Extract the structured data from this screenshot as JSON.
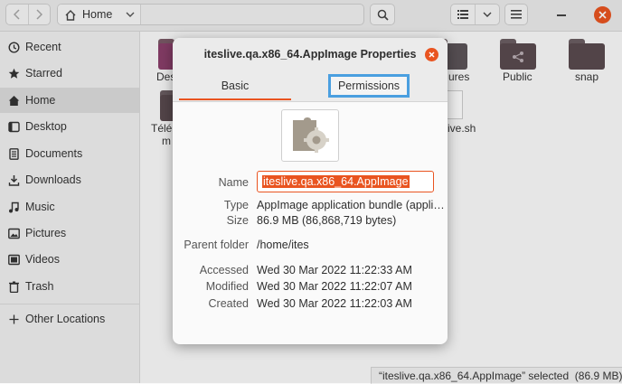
{
  "header": {
    "back_icon": "chevron-left-icon",
    "forward_icon": "chevron-right-icon",
    "path_home_label": "Home",
    "path_dropdown_icon": "chevron-down-icon",
    "search_icon": "search-icon",
    "view_list_icon": "list-view-icon",
    "view_options_icon": "chevron-down-icon",
    "menu_icon": "hamburger-menu-icon",
    "window_minimize_icon": "minimize-icon",
    "window_close_icon": "close-icon"
  },
  "sidebar": {
    "items": [
      {
        "label": "Recent",
        "icon": "clock-icon"
      },
      {
        "label": "Starred",
        "icon": "star-icon"
      },
      {
        "label": "Home",
        "icon": "home-icon"
      },
      {
        "label": "Desktop",
        "icon": "desktop-icon"
      },
      {
        "label": "Documents",
        "icon": "documents-icon"
      },
      {
        "label": "Downloads",
        "icon": "download-icon"
      },
      {
        "label": "Music",
        "icon": "music-icon"
      },
      {
        "label": "Pictures",
        "icon": "pictures-icon"
      },
      {
        "label": "Videos",
        "icon": "videos-icon"
      },
      {
        "label": "Trash",
        "icon": "trash-icon"
      }
    ],
    "other_locations": "Other Locations"
  },
  "content": {
    "files": [
      {
        "label": "Des"
      },
      {
        "label": "ures"
      },
      {
        "label": "Public"
      },
      {
        "label": "snap"
      },
      {
        "label": "Télé"
      },
      {
        "label": "m"
      },
      {
        "label": "ive.sh"
      }
    ],
    "status": "“iteslive.qa.x86_64.AppImage” selected  (86.9 MB)"
  },
  "dialog": {
    "title": "iteslive.qa.x86_64.AppImage Properties",
    "close_icon": "close-icon",
    "tabs": {
      "basic": "Basic",
      "permissions": "Permissions"
    },
    "app_icon": "puzzle-gear-icon",
    "labels": {
      "name": "Name",
      "type": "Type",
      "size": "Size",
      "parent_folder": "Parent folder",
      "accessed": "Accessed",
      "modified": "Modified",
      "created": "Created"
    },
    "values": {
      "name": "iteslive.qa.x86_64.AppImage",
      "type": "AppImage application bundle (appli…",
      "size": "86.9 MB (86,868,719 bytes)",
      "parent_folder": "/home/ites",
      "accessed": "Wed 30 Mar 2022 11:22:33 AM",
      "modified": "Wed 30 Mar 2022 11:22:07 AM",
      "created": "Wed 30 Mar 2022 11:22:03 AM"
    }
  },
  "colors": {
    "accent": "#e95420",
    "folder": "#5a4a4f",
    "highlight_border": "#4a9fe0"
  }
}
